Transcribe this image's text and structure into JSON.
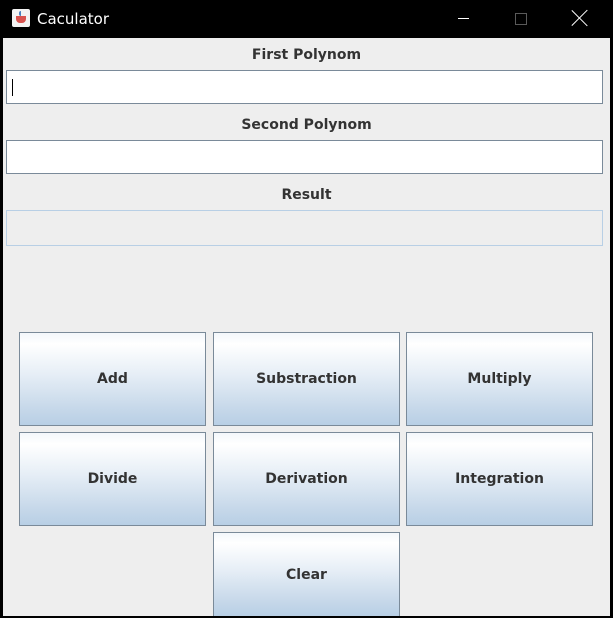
{
  "window": {
    "title": "Caculator"
  },
  "form": {
    "first_label": "First Polynom",
    "first_value": "",
    "second_label": "Second Polynom",
    "second_value": "",
    "result_label": "Result",
    "result_value": ""
  },
  "buttons": {
    "add": "Add",
    "subtraction": "Substraction",
    "multiply": "Multiply",
    "divide": "Divide",
    "derivation": "Derivation",
    "integration": "Integration",
    "clear": "Clear"
  },
  "colors": {
    "titlebar": "#000000",
    "content_bg": "#eeeeee",
    "button_gradient_bottom": "#b8cfe5"
  }
}
